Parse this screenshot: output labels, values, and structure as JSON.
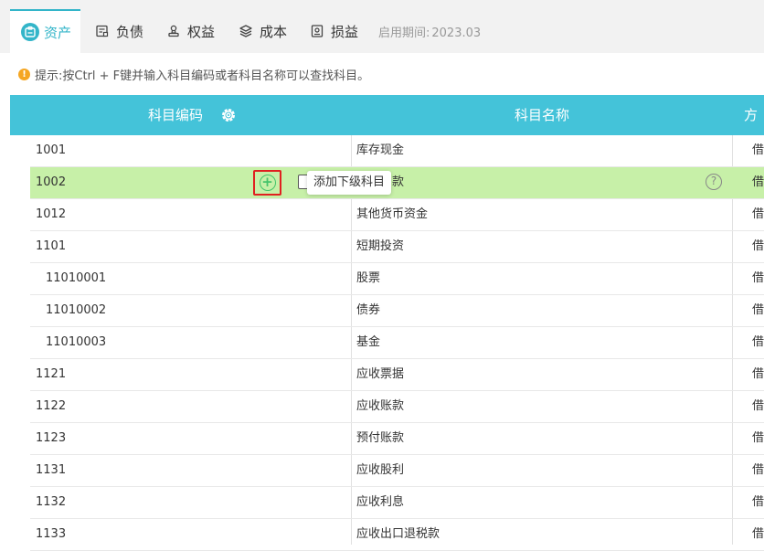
{
  "tabs": [
    {
      "label": "资产",
      "icon": "asset-icon",
      "active": true
    },
    {
      "label": "负债",
      "icon": "liability-icon",
      "active": false
    },
    {
      "label": "权益",
      "icon": "equity-icon",
      "active": false
    },
    {
      "label": "成本",
      "icon": "cost-icon",
      "active": false
    },
    {
      "label": "损益",
      "icon": "profit-loss-icon",
      "active": false
    }
  ],
  "period": {
    "label": "启用期间:",
    "value": "2023.03"
  },
  "hint": {
    "icon": "info-icon",
    "text": "提示:按Ctrl + F键并输入科目编码或者科目名称可以查找科目。"
  },
  "columns": {
    "code": "科目编码",
    "name": "科目名称",
    "direction": "方向",
    "settings_icon": "gear-icon"
  },
  "rows": [
    {
      "code": "1001",
      "name": "库存现金",
      "direction": "借",
      "child": false
    },
    {
      "code": "1002",
      "name": "款",
      "direction": "借",
      "child": false,
      "selected": true
    },
    {
      "code": "1012",
      "name": "其他货币资金",
      "direction": "借",
      "child": false
    },
    {
      "code": "1101",
      "name": "短期投资",
      "direction": "借",
      "child": false
    },
    {
      "code": "11010001",
      "name": "股票",
      "direction": "借",
      "child": true
    },
    {
      "code": "11010002",
      "name": "债券",
      "direction": "借",
      "child": true
    },
    {
      "code": "11010003",
      "name": "基金",
      "direction": "借",
      "child": true
    },
    {
      "code": "1121",
      "name": "应收票据",
      "direction": "借",
      "child": false
    },
    {
      "code": "1122",
      "name": "应收账款",
      "direction": "借",
      "child": false
    },
    {
      "code": "1123",
      "name": "预付账款",
      "direction": "借",
      "child": false
    },
    {
      "code": "1131",
      "name": "应收股利",
      "direction": "借",
      "child": false
    },
    {
      "code": "1132",
      "name": "应收利息",
      "direction": "借",
      "child": false
    },
    {
      "code": "1133",
      "name": "应收出口退税款",
      "direction": "借",
      "child": false
    }
  ],
  "row_actions": {
    "add_icon": "add-circle-icon",
    "edit_icon": "edit-icon",
    "help_icon": "help-icon",
    "tooltip": "添加下级科目"
  },
  "colors": {
    "accent": "#44c3d9",
    "selected_row": "#c7f0a8",
    "highlight_border": "#e02020",
    "add_green": "#45c36a"
  }
}
